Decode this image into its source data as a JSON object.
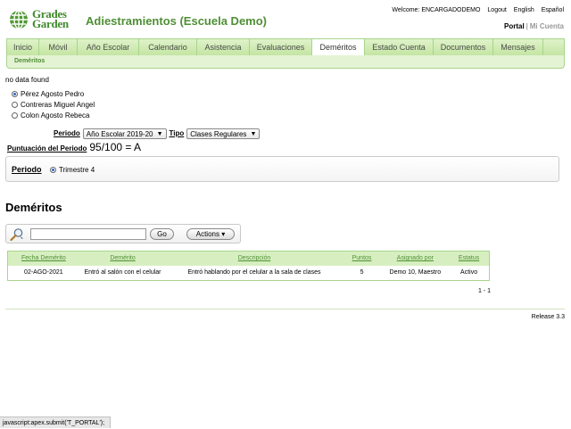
{
  "header": {
    "brand_line1": "Grades",
    "brand_line2": "Garden",
    "app_title": "Adiestramientos (Escuela Demo)",
    "welcome": "Welcome: ENCARGADODEMO",
    "logout": "Logout",
    "english": "English",
    "espanol": "Español",
    "portal": "Portal",
    "mi_cuenta": "Mi Cuenta",
    "brand_color": "#4f8f35"
  },
  "tabs": [
    {
      "label": "Inicio"
    },
    {
      "label": "Móvil"
    },
    {
      "label": "Año Escolar"
    },
    {
      "label": "Calendario"
    },
    {
      "label": "Asistencia"
    },
    {
      "label": "Evaluaciones"
    },
    {
      "label": "Deméritos",
      "active": true
    },
    {
      "label": "Estado Cuenta"
    },
    {
      "label": "Documentos"
    },
    {
      "label": "Mensajes"
    }
  ],
  "subtab": "Deméritos",
  "no_data": "no data found",
  "students": [
    {
      "name": "Pérez Agosto Pedro",
      "selected": true
    },
    {
      "name": "Contreras Miguel Angel",
      "selected": false
    },
    {
      "name": "Colon Agosto Rebeca",
      "selected": false
    }
  ],
  "filters": {
    "periodo_label": "Periodo",
    "periodo_value": "Año Escolar 2019-20",
    "tipo_label": "Tipo",
    "tipo_value": "Clases Regulares"
  },
  "score": {
    "label": "Puntuación del Periodo",
    "value": "95/100 = A"
  },
  "periodo_box": {
    "label": "Periodo",
    "option": "Trimestre 4"
  },
  "section_title": "Deméritos",
  "search": {
    "value": "",
    "go_label": "Go",
    "actions_label": "Actions"
  },
  "table": {
    "headers": [
      "Fecha Demérito",
      "Demérito",
      "Descripción",
      "Puntos",
      "Asignado por",
      "Estatus"
    ],
    "rows": [
      [
        "02-AGO-2021",
        "Entró al salón con el celular",
        "Entró hablando por el celular a la sala de clases",
        "5",
        "Demo 10, Maestro",
        "Activo"
      ]
    ]
  },
  "pager": "1 - 1",
  "release": "Release 3.3",
  "statusbar": "javascript:apex.submit('T_PORTAL');"
}
